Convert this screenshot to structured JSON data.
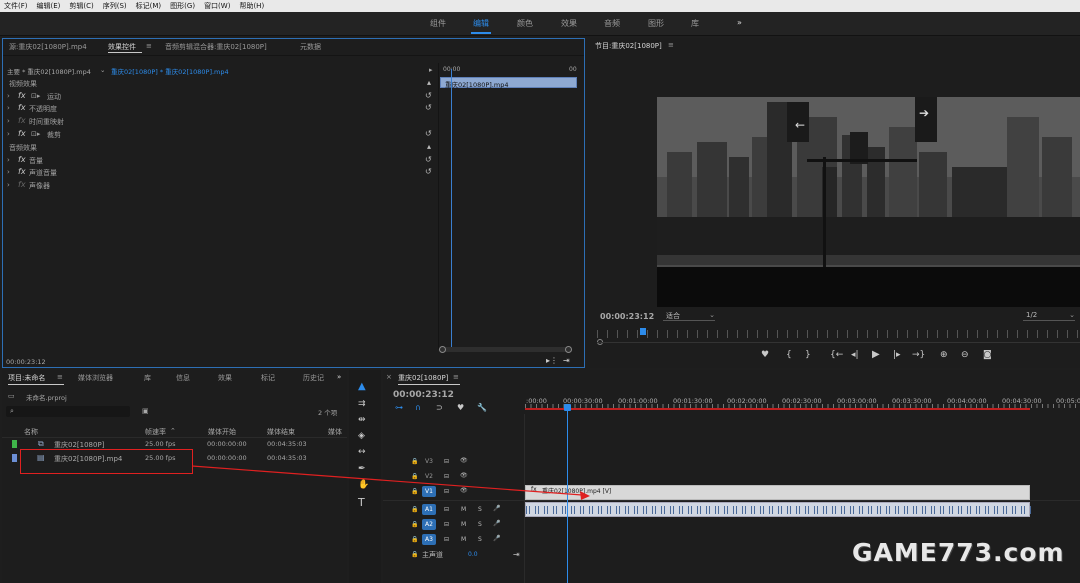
{
  "menu": [
    "文件(F)",
    "编辑(E)",
    "剪辑(C)",
    "序列(S)",
    "标记(M)",
    "图形(G)",
    "窗口(W)",
    "帮助(H)"
  ],
  "workspaces": [
    "组件",
    "编辑",
    "颜色",
    "效果",
    "音频",
    "图形",
    "库"
  ],
  "workspace_active": "编辑",
  "workspace_more": "»",
  "effects_panel": {
    "tabs": [
      "源:重庆02[1080P].mp4",
      "效果控件",
      "音频剪辑混合器:重庆02[1080P]",
      "元数据"
    ],
    "menu_icon": "≡",
    "master_label": "主要 * 重庆02[1080P].mp4",
    "sequence_label": "重庆02[1080P] * 重庆02[1080P].mp4",
    "timecode_start": "00:00",
    "timecode_end": "00",
    "clip_label": "重庆02[1080P].mp4",
    "video_section": "视频效果",
    "video_effects": [
      "运动",
      "不透明度",
      "时间重映射",
      "裁剪"
    ],
    "audio_section": "音频效果",
    "audio_effects": [
      "音量",
      "声道音量",
      "声像器"
    ],
    "timecode": "00:00:23:12"
  },
  "program_panel": {
    "title": "节目:重庆02[1080P]",
    "timecode": "00:00:23:12",
    "fit": "适合",
    "quality": "1/2",
    "controls": [
      "marker-icon",
      "mark-in-icon",
      "mark-out-icon",
      "go-to-in-icon",
      "step-back-icon",
      "play-icon",
      "step-forward-icon",
      "go-to-out-icon",
      "lift-icon",
      "extract-icon",
      "export-frame-icon"
    ]
  },
  "project_panel": {
    "tabs": [
      "项目:未命名",
      "媒体浏览器",
      "库",
      "信息",
      "效果",
      "标记",
      "历史记"
    ],
    "more": "»",
    "project_file": "未命名.prproj",
    "item_count": "2 个项",
    "columns": [
      "名称",
      "帧速率",
      "媒体开始",
      "媒体结束",
      "媒体"
    ],
    "items": [
      {
        "name": "重庆02[1080P]",
        "fps": "25.00 fps",
        "start": "00:00:00:00",
        "end": "00:04:35:03",
        "color": "#3fb54a"
      },
      {
        "name": "重庆02[1080P].mp4",
        "fps": "25.00 fps",
        "start": "00:00:00:00",
        "end": "00:04:35:03",
        "color": "#6c8fd6"
      }
    ]
  },
  "tools": [
    "selection-tool",
    "track-select-tool",
    "ripple-edit-tool",
    "razor-tool",
    "slip-tool",
    "pen-tool",
    "hand-tool",
    "type-tool"
  ],
  "timeline": {
    "title": "重庆02[1080P]",
    "timecode": "00:00:23:12",
    "ruler": [
      ":00:00",
      "00:00:30:00",
      "00:01:00:00",
      "00:01:30:00",
      "00:02:00:00",
      "00:02:30:00",
      "00:03:00:00",
      "00:03:30:00",
      "00:04:00:00",
      "00:04:30:00",
      "00:05:0"
    ],
    "video_tracks": [
      "V3",
      "V2",
      "V1"
    ],
    "audio_tracks": [
      "A1",
      "A2",
      "A3"
    ],
    "master": "主声道",
    "master_value": "0.0",
    "clip_label": "重庆02[1080P].mp4 [V]",
    "track_toggles": [
      "M",
      "S"
    ]
  },
  "watermark": "GAME773.com",
  "colors": {
    "accent": "#2d8ceb",
    "clip_video": "#d8d8d8",
    "annotation_red": "#e02020"
  }
}
